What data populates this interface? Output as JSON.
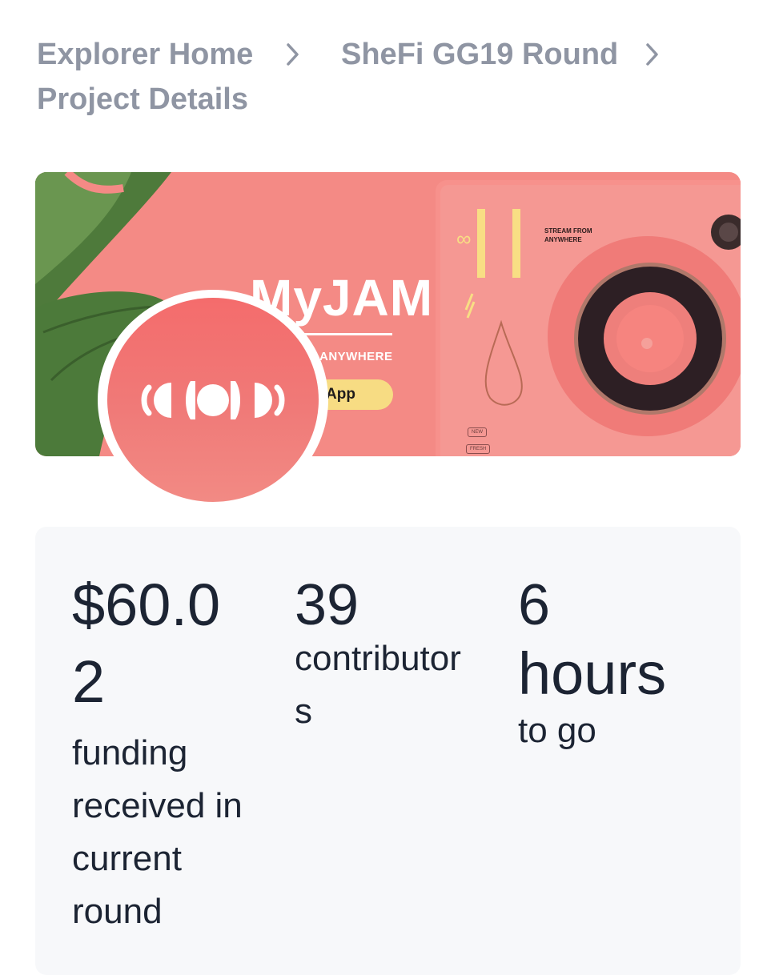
{
  "breadcrumb": {
    "items": [
      "Explorer Home",
      "SheFi GG19 Round",
      "Project Details"
    ]
  },
  "banner": {
    "title": "MyJAM",
    "tagline": "ANYWHERE",
    "cta_label": "App",
    "device_text": "STREAM FROM ANYWHERE",
    "badge_new": "NEW",
    "badge_fresh": "FRESH",
    "colors": {
      "background": "#f48a85",
      "leaf": "#4f7a3c",
      "accent": "#f7dc83"
    }
  },
  "avatar": {
    "icon": "myjam-logo-icon"
  },
  "stats": {
    "funding": {
      "value": "$60.02",
      "label": "funding received in current round"
    },
    "contributors": {
      "value": "39",
      "label": "contributors"
    },
    "time": {
      "value": "6",
      "unit": "hours",
      "label": "to go"
    }
  }
}
